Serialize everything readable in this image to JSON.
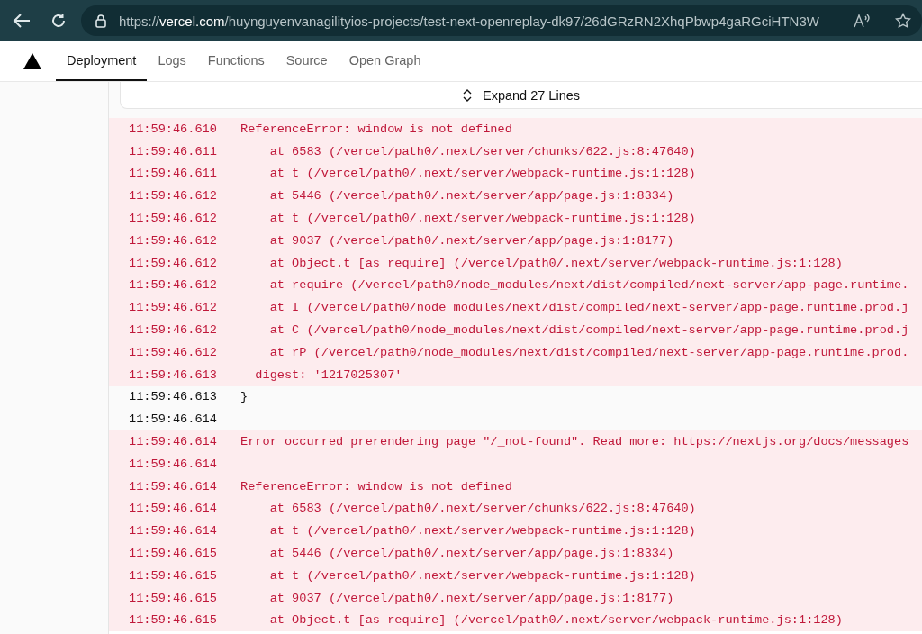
{
  "browser": {
    "url": "https://**vercel.com**/huynguyenvanagilityios-projects/test-next-openreplay-dk97/26dGRzRN2XhqPbwp4gaRGciHTN3W"
  },
  "tabs": [
    {
      "label": "Deployment",
      "selected": true
    },
    {
      "label": "Logs",
      "selected": false
    },
    {
      "label": "Functions",
      "selected": false
    },
    {
      "label": "Source",
      "selected": false
    },
    {
      "label": "Open Graph",
      "selected": false
    }
  ],
  "expand": {
    "label": "Expand 27 Lines"
  },
  "log_rows": [
    {
      "kind": "error",
      "time": "11:59:46.610",
      "message": "ReferenceError: window is not defined"
    },
    {
      "kind": "error",
      "time": "11:59:46.611",
      "message": "    at 6583 (/vercel/path0/.next/server/chunks/622.js:8:47640)"
    },
    {
      "kind": "error",
      "time": "11:59:46.611",
      "message": "    at t (/vercel/path0/.next/server/webpack-runtime.js:1:128)"
    },
    {
      "kind": "error",
      "time": "11:59:46.612",
      "message": "    at 5446 (/vercel/path0/.next/server/app/page.js:1:8334)"
    },
    {
      "kind": "error",
      "time": "11:59:46.612",
      "message": "    at t (/vercel/path0/.next/server/webpack-runtime.js:1:128)"
    },
    {
      "kind": "error",
      "time": "11:59:46.612",
      "message": "    at 9037 (/vercel/path0/.next/server/app/page.js:1:8177)"
    },
    {
      "kind": "error",
      "time": "11:59:46.612",
      "message": "    at Object.t [as require] (/vercel/path0/.next/server/webpack-runtime.js:1:128)"
    },
    {
      "kind": "error",
      "time": "11:59:46.612",
      "message": "    at require (/vercel/path0/node_modules/next/dist/compiled/next-server/app-page.runtime."
    },
    {
      "kind": "error",
      "time": "11:59:46.612",
      "message": "    at I (/vercel/path0/node_modules/next/dist/compiled/next-server/app-page.runtime.prod.j"
    },
    {
      "kind": "error",
      "time": "11:59:46.612",
      "message": "    at C (/vercel/path0/node_modules/next/dist/compiled/next-server/app-page.runtime.prod.j"
    },
    {
      "kind": "error",
      "time": "11:59:46.612",
      "message": "    at rP (/vercel/path0/node_modules/next/dist/compiled/next-server/app-page.runtime.prod."
    },
    {
      "kind": "error",
      "time": "11:59:46.613",
      "message": "  digest: '1217025307'"
    },
    {
      "kind": "normal",
      "time": "11:59:46.613",
      "message": "}"
    },
    {
      "kind": "normal",
      "time": "11:59:46.614"
    },
    {
      "kind": "error",
      "time": "11:59:46.614",
      "message": "Error occurred prerendering page \"/_not-found\". Read more: https://nextjs.org/docs/messages"
    },
    {
      "kind": "error",
      "time": "11:59:46.614"
    },
    {
      "kind": "error",
      "time": "11:59:46.614",
      "message": "ReferenceError: window is not defined"
    },
    {
      "kind": "error",
      "time": "11:59:46.614",
      "message": "    at 6583 (/vercel/path0/.next/server/chunks/622.js:8:47640)"
    },
    {
      "kind": "error",
      "time": "11:59:46.614",
      "message": "    at t (/vercel/path0/.next/server/webpack-runtime.js:1:128)"
    },
    {
      "kind": "error",
      "time": "11:59:46.615",
      "message": "    at 5446 (/vercel/path0/.next/server/app/page.js:1:8334)"
    },
    {
      "kind": "error",
      "time": "11:59:46.615",
      "message": "    at t (/vercel/path0/.next/server/webpack-runtime.js:1:128)"
    },
    {
      "kind": "error",
      "time": "11:59:46.615",
      "message": "    at 9037 (/vercel/path0/.next/server/app/page.js:1:8177)"
    },
    {
      "kind": "error",
      "time": "11:59:46.615",
      "message": "    at Object.t [as require] (/vercel/path0/.next/server/webpack-runtime.js:1:128)"
    }
  ]
}
